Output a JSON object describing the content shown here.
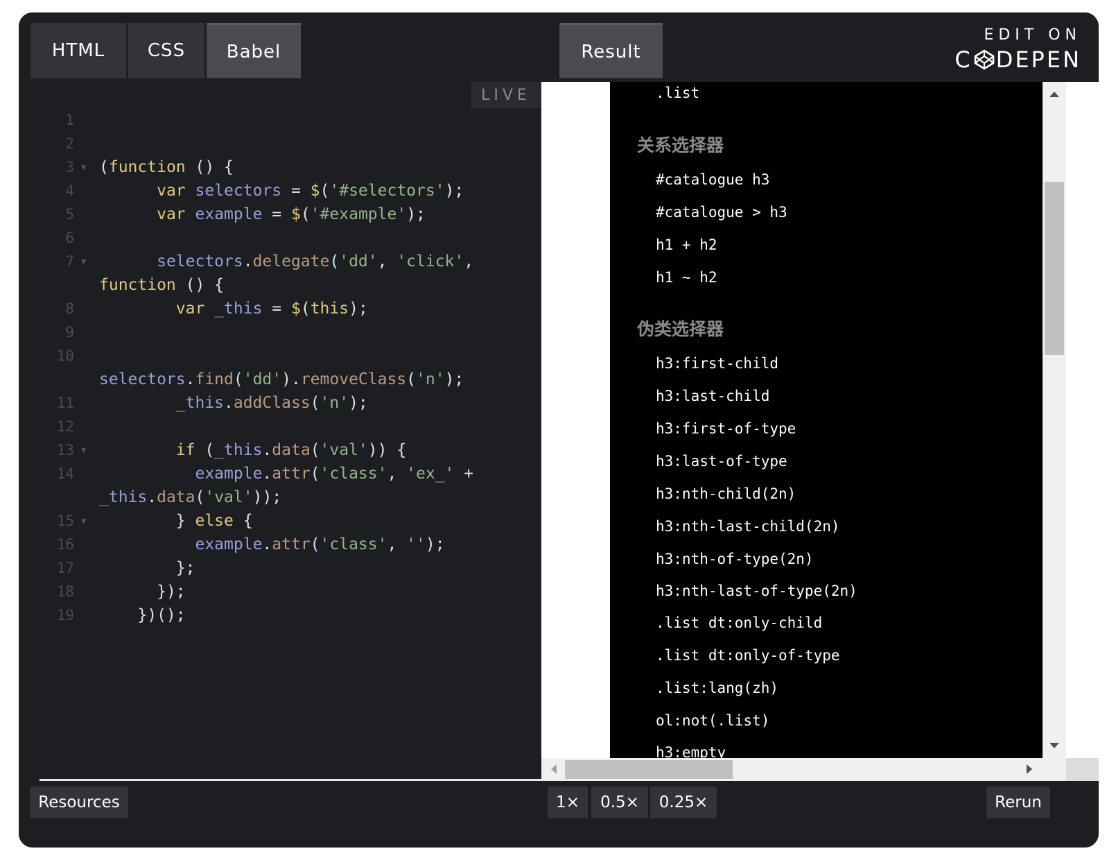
{
  "tabs": {
    "html": "HTML",
    "css": "CSS",
    "babel": "Babel",
    "result": "Result"
  },
  "brand": {
    "edit_on": "EDIT ON",
    "codepen_c": "C",
    "codepen_rest": "DEPEN"
  },
  "editor": {
    "live_label": "LIVE",
    "line_numbers": [
      "1",
      "2",
      "3",
      "4",
      "5",
      "6",
      "7",
      "8",
      "9",
      "10",
      "11",
      "12",
      "13",
      "14",
      "15",
      "16",
      "17",
      "18",
      "19"
    ]
  },
  "result": {
    "items": {
      "list": ".list",
      "heading_relation": "关系选择器",
      "catalogue_h3": "#catalogue h3",
      "catalogue_child_h3": "#catalogue > h3",
      "h1_plus_h2": "h1 + h2",
      "h1_tilde_h2": "h1 ~ h2",
      "heading_pseudo": "伪类选择器",
      "first_child": "h3:first-child",
      "last_child": "h3:last-child",
      "first_of_type": "h3:first-of-type",
      "last_of_type": "h3:last-of-type",
      "nth_child": "h3:nth-child(2n)",
      "nth_last_child": "h3:nth-last-child(2n)",
      "nth_of_type": "h3:nth-of-type(2n)",
      "nth_last_of_type": "h3:nth-last-of-type(2n)",
      "only_child": ".list dt:only-child",
      "only_of_type": ".list dt:only-of-type",
      "lang": ".list:lang(zh)",
      "not_list": "ol:not(.list)",
      "empty": "h3:empty"
    }
  },
  "bottom": {
    "resources": "Resources",
    "zoom_1x": "1×",
    "zoom_05x": "0.5×",
    "zoom_025x": "0.25×",
    "rerun": "Rerun"
  }
}
